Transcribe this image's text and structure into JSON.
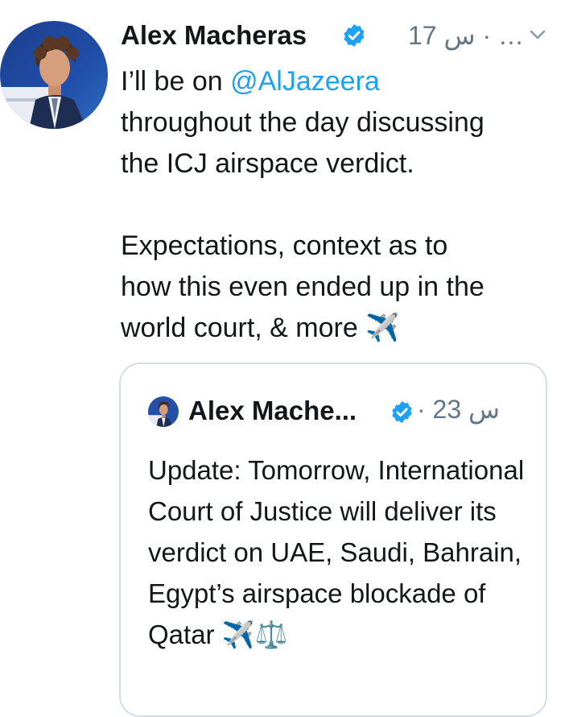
{
  "tweet": {
    "author_name": "Alex Macheras",
    "meta": "17 س · …",
    "text_line1_prefix": "I’ll be on ",
    "mention": "@AlJazeera",
    "text_rest": "throughout the day discussing\nthe ICJ airspace verdict.\n\nExpectations, context as to\nhow this even ended up in the\nworld court, & more ✈️"
  },
  "quoted_tweet": {
    "author_name": "Alex Mache...",
    "meta": "· 23 س",
    "text": "Update: Tomorrow, International Court of Justice will deliver its verdict on UAE, Saudi, Bahrain, Egypt’s airspace blockade of Qatar ✈️⚖️"
  },
  "icons": {
    "verified": "verified-badge-icon",
    "caret": "chevron-down-icon"
  },
  "colors": {
    "text": "#14171a",
    "secondary": "#657786",
    "link": "#1da1f2",
    "verified": "#1da1f2",
    "card_border": "#d5dde2"
  }
}
